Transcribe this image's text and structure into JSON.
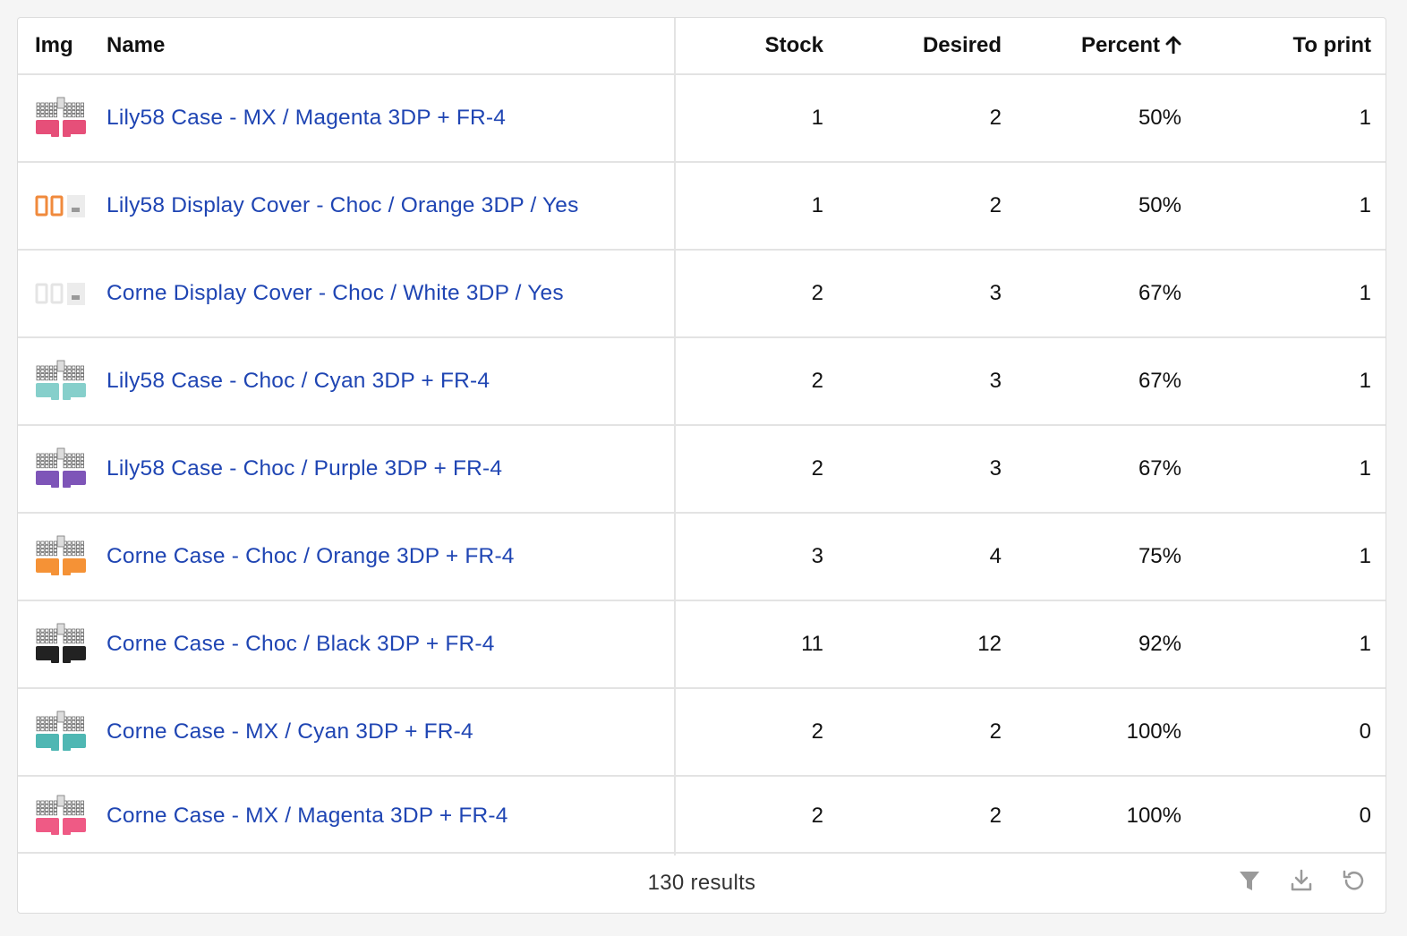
{
  "columns": {
    "img": "Img",
    "name": "Name",
    "stock": "Stock",
    "desired": "Desired",
    "percent": "Percent",
    "to_print": "To print"
  },
  "sort": {
    "column": "percent",
    "direction": "ascending",
    "icon": "arrow-up-icon"
  },
  "rows": [
    {
      "thumb": "keyboard-case",
      "color": "#e64f79",
      "name": "Lily58 Case - MX / Magenta 3DP + FR-4",
      "stock": "1",
      "desired": "2",
      "percent": "50%",
      "to_print": "1"
    },
    {
      "thumb": "display-cover",
      "color": "#f08a3c",
      "name": "Lily58 Display Cover - Choc / Orange 3DP / Yes",
      "stock": "1",
      "desired": "2",
      "percent": "50%",
      "to_print": "1"
    },
    {
      "thumb": "display-cover",
      "color": "#f2f2f2",
      "name": "Corne Display Cover - Choc / White 3DP / Yes",
      "stock": "2",
      "desired": "3",
      "percent": "67%",
      "to_print": "1"
    },
    {
      "thumb": "keyboard-case",
      "color": "#86cfcb",
      "name": "Lily58 Case - Choc / Cyan 3DP + FR-4",
      "stock": "2",
      "desired": "3",
      "percent": "67%",
      "to_print": "1"
    },
    {
      "thumb": "keyboard-case",
      "color": "#7e55b8",
      "name": "Lily58 Case - Choc / Purple 3DP + FR-4",
      "stock": "2",
      "desired": "3",
      "percent": "67%",
      "to_print": "1"
    },
    {
      "thumb": "keyboard-case",
      "color": "#f59236",
      "name": "Corne Case - Choc / Orange 3DP + FR-4",
      "stock": "3",
      "desired": "4",
      "percent": "75%",
      "to_print": "1"
    },
    {
      "thumb": "keyboard-case",
      "color": "#222222",
      "name": "Corne Case - Choc / Black 3DP + FR-4",
      "stock": "11",
      "desired": "12",
      "percent": "92%",
      "to_print": "1"
    },
    {
      "thumb": "keyboard-case",
      "color": "#4fb7b3",
      "name": "Corne Case - MX / Cyan 3DP + FR-4",
      "stock": "2",
      "desired": "2",
      "percent": "100%",
      "to_print": "0"
    },
    {
      "thumb": "keyboard-case",
      "color": "#ef5a85",
      "name": "Corne Case - MX / Magenta 3DP + FR-4",
      "stock": "2",
      "desired": "2",
      "percent": "100%",
      "to_print": "0"
    }
  ],
  "footer": {
    "results": "130 results",
    "tools": [
      "filter-icon",
      "download-icon",
      "refresh-icon"
    ]
  },
  "colors": {
    "link": "#1f45b3",
    "border": "#e3e3e3",
    "icon": "#9a9a9a"
  }
}
